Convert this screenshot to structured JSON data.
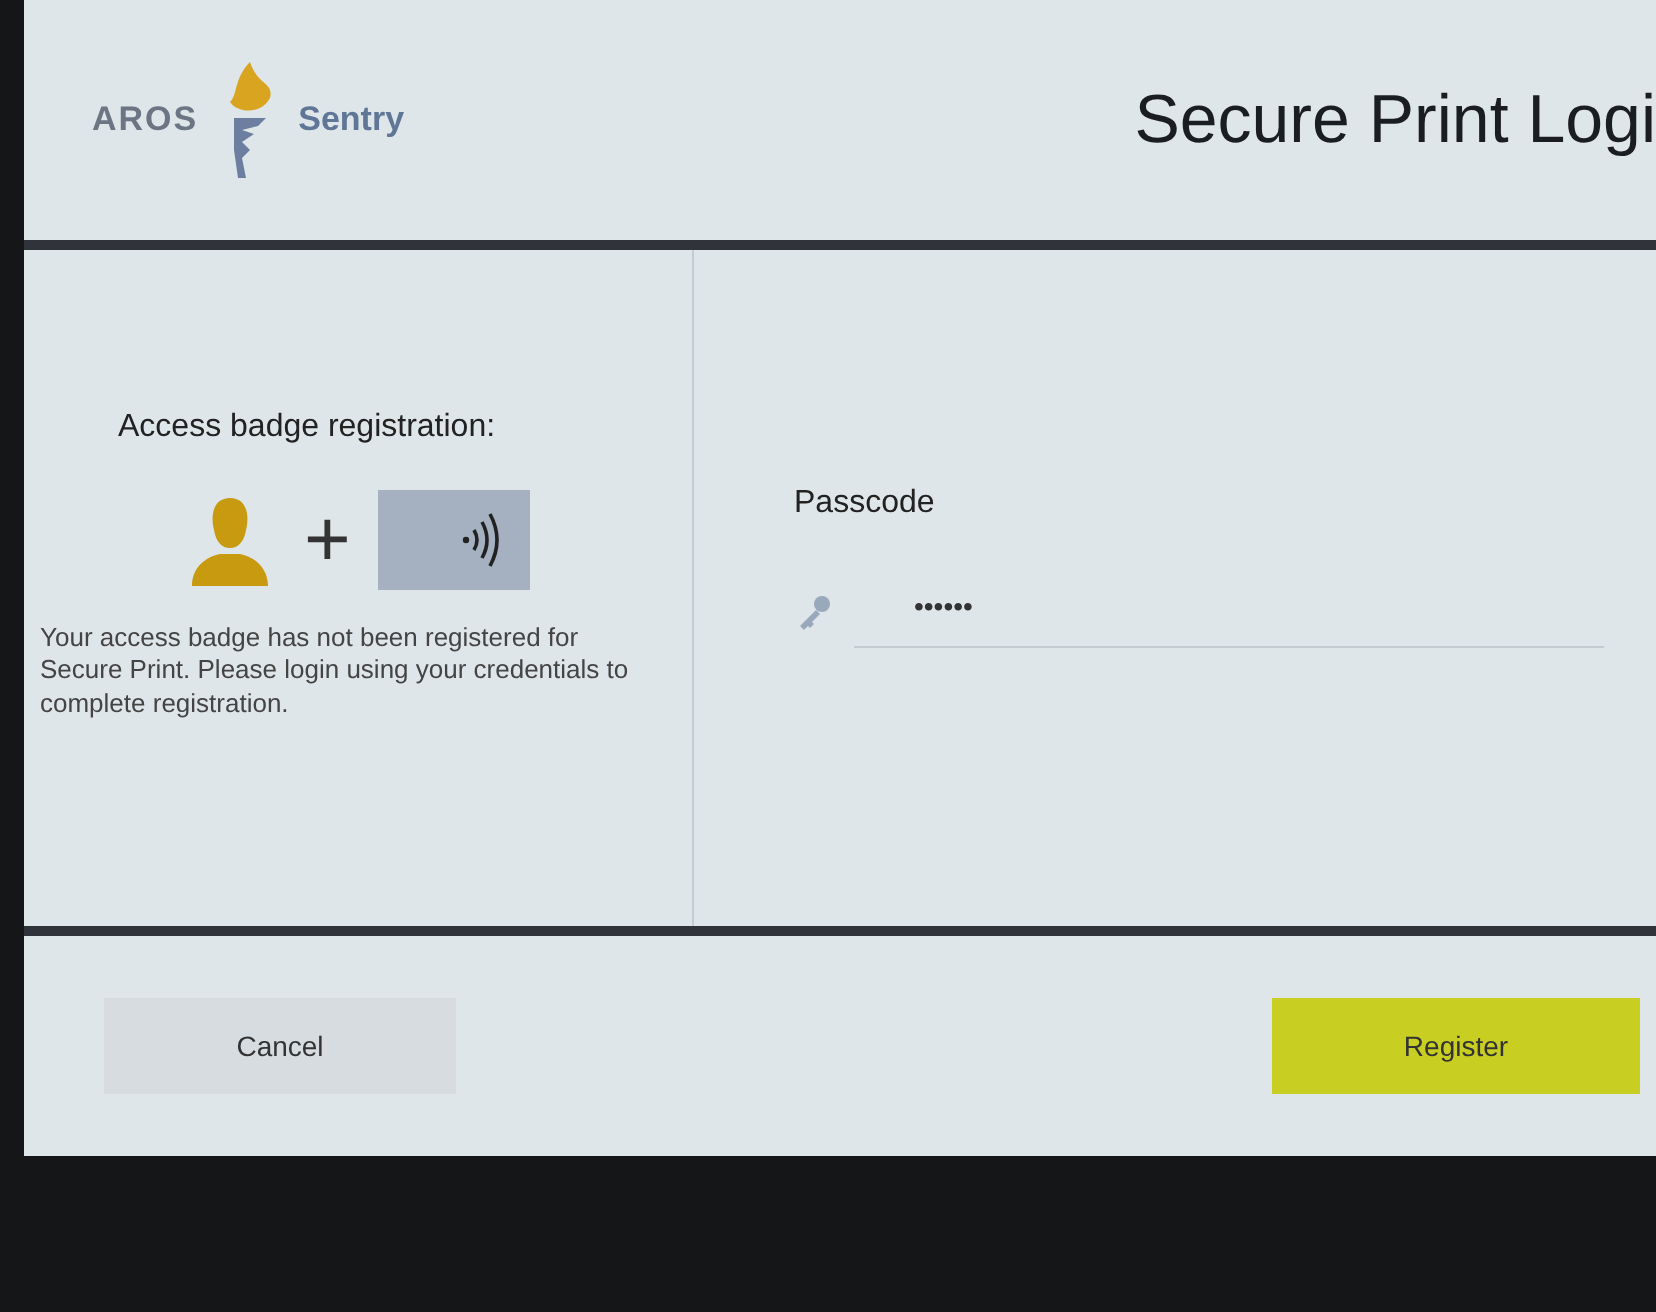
{
  "header": {
    "logo_left": "AROS",
    "logo_right": "Sentry",
    "title": "Secure Print Logi"
  },
  "badge_registration": {
    "heading": "Access badge registration:",
    "plus": "+",
    "message": "Your access badge has not been registered for Secure Print. Please login using your credentials to complete registration."
  },
  "passcode": {
    "label": "Passcode",
    "value": "••••••"
  },
  "buttons": [
    {
      "label": "Cancel",
      "kind": "secondary"
    },
    {
      "label": "Register",
      "kind": "primary"
    }
  ]
}
